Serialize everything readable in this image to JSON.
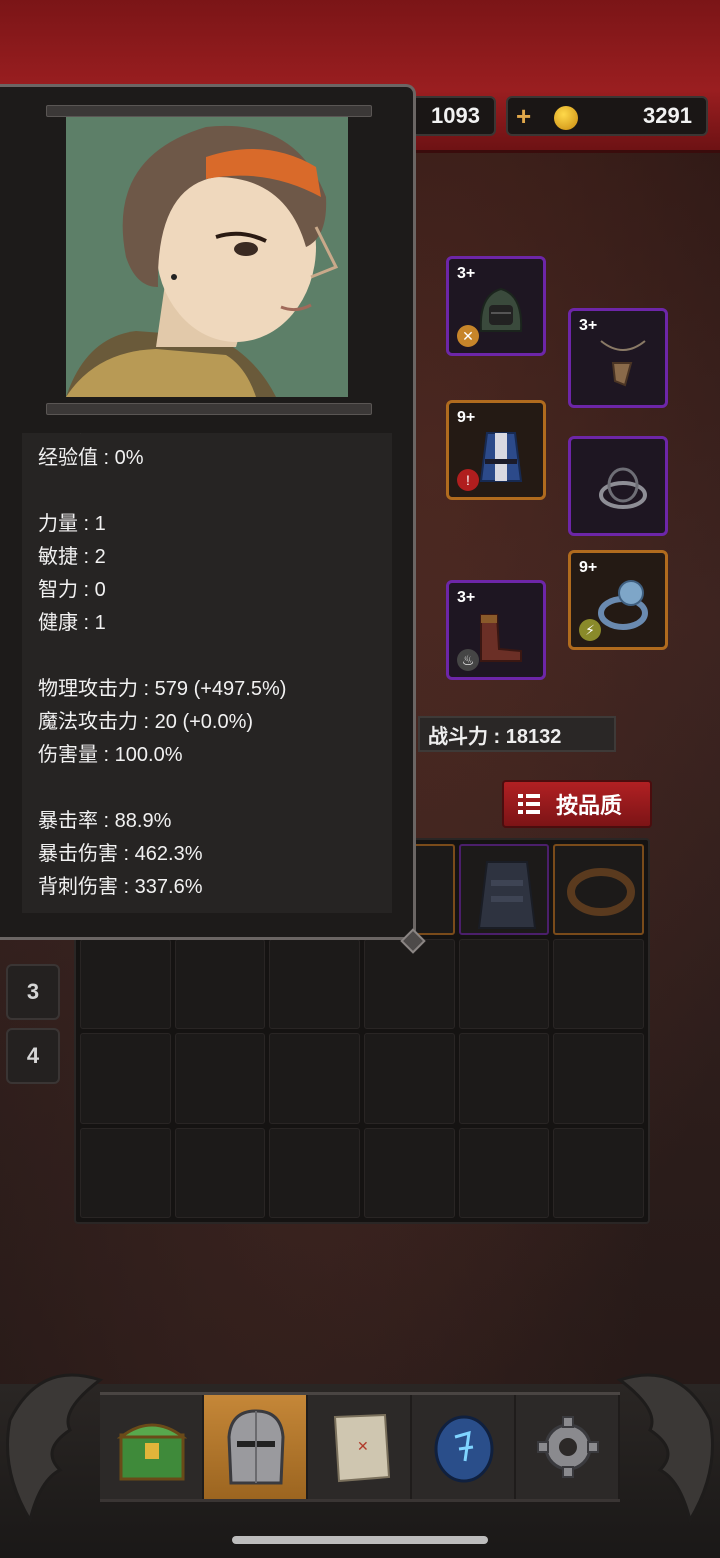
{
  "currency": {
    "gems": "1093",
    "gold": "3291"
  },
  "equipment": {
    "helmet_level": "3+",
    "amulet_level": "3+",
    "armor_level": "9+",
    "boots_level": "3+",
    "ring_level": "9+"
  },
  "power": {
    "label": "战斗力 : 18132"
  },
  "sort_button": {
    "label": "按品质"
  },
  "page_tabs": [
    "3",
    "4"
  ],
  "stats": {
    "combat_power": "战斗力 : 18132",
    "exp": "经验值 : 0%",
    "strength": "力量 : 1",
    "agility": "敏捷 : 2",
    "intelligence": "智力 : 0",
    "health": "健康 : 1",
    "physical_attack": "物理攻击力 : 579 (+497.5%)",
    "magic_attack": "魔法攻击力 : 20 (+0.0%)",
    "damage": "伤害量 : 100.0%",
    "crit_rate": "暴击率 : 88.9%",
    "crit_damage": "暴击伤害 : 462.3%",
    "backstab_damage": "背刺伤害 : 337.6%"
  },
  "colors": {
    "epic": "#6d26a8",
    "legendary": "#b06b1e",
    "topbar": "#9a1e20",
    "active_nav": "#c58738"
  },
  "nav_icons": [
    "treasure-chest-icon",
    "knight-helmet-icon",
    "map-icon",
    "rune-stone-icon",
    "gear-icon"
  ]
}
